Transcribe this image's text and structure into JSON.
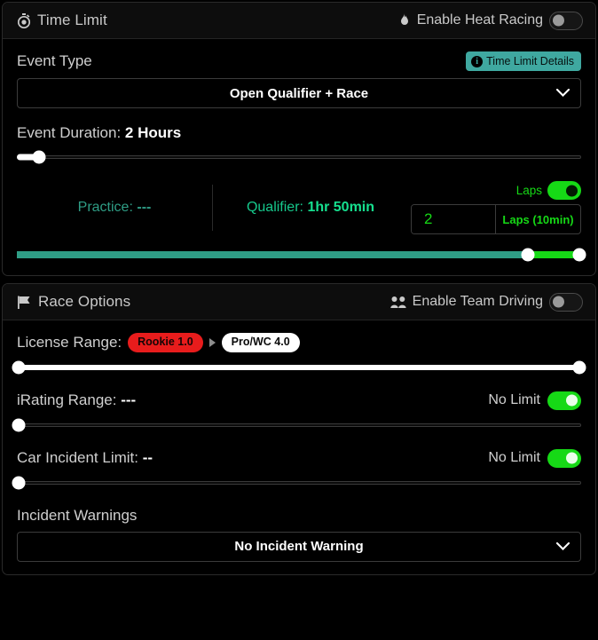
{
  "time_limit_card": {
    "header": {
      "icon": "stopwatch-icon",
      "title": "Time Limit",
      "toggle": {
        "icon": "flame-icon",
        "label": "Enable Heat Racing",
        "state": "off"
      }
    },
    "event_type": {
      "label": "Event Type",
      "details_button": {
        "label": "Time Limit Details",
        "icon": "info-icon"
      },
      "selected_value": "Open Qualifier + Race",
      "chevron": "chevron-down-icon"
    },
    "event_duration": {
      "label_prefix": "Event Duration:",
      "value": "2 Hours",
      "slider_percent": 4
    },
    "breakdown": {
      "practice_label": "Practice:",
      "practice_value": "---",
      "qualifier_label": "Qualifier:",
      "qualifier_value": "1hr 50min",
      "laps_toggle_label": "Laps",
      "laps_toggle_state": "on",
      "laps_value": "2",
      "laps_unit": "Laps (10min)"
    },
    "composition_slider": {
      "handle1_percent": 90.5,
      "handle2_percent": 100,
      "teal_color": "#2f9e86",
      "green_color": "#16d916"
    }
  },
  "race_options_card": {
    "header": {
      "icon": "flag-icon",
      "title": "Race Options",
      "toggle": {
        "icon": "team-icon",
        "label": "Enable Team Driving",
        "state": "off"
      }
    },
    "license_range": {
      "label": "License Range:",
      "min_pill": "Rookie 1.0",
      "max_pill": "Pro/WC 4.0",
      "min_percent": 0,
      "max_percent": 100
    },
    "irating_range": {
      "label_prefix": "iRating Range:",
      "value": "---",
      "no_limit_label": "No Limit",
      "no_limit_state": "on",
      "handle_percent": 0
    },
    "car_incident_limit": {
      "label_prefix": "Car Incident Limit:",
      "value": "--",
      "no_limit_label": "No Limit",
      "no_limit_state": "on",
      "handle_percent": 0
    },
    "incident_warnings": {
      "label": "Incident Warnings",
      "selected_value": "No Incident Warning",
      "chevron": "chevron-down-icon"
    }
  }
}
